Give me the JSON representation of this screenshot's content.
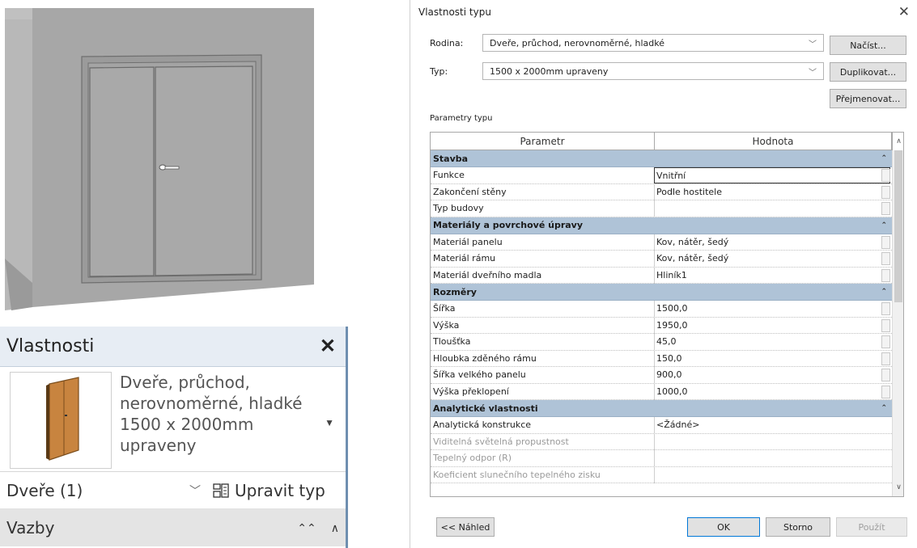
{
  "dialog": {
    "title": "Vlastnosti typu",
    "close_glyph": "✕",
    "family_label": "Rodina:",
    "family_value": "Dveře, průchod, nerovnoměrné, hladké",
    "type_label": "Typ:",
    "type_value": "1500 x 2000mm upraveny",
    "load_button": "Načíst...",
    "duplicate_button": "Duplikovat...",
    "rename_button": "Přejmenovat...",
    "section_label": "Parametry typu",
    "col_param": "Parametr",
    "col_value": "Hodnota",
    "col_eq": "=",
    "groups": [
      {
        "name": "Stavba",
        "rows": [
          {
            "name": "Funkce",
            "value": "Vnitřní"
          },
          {
            "name": "Zakončení stěny",
            "value": "Podle hostitele"
          },
          {
            "name": "Typ budovy",
            "value": ""
          }
        ]
      },
      {
        "name": "Materiály a povrchové úpravy",
        "rows": [
          {
            "name": "Materiál panelu",
            "value": "Kov, nátěr, šedý"
          },
          {
            "name": "Materiál rámu",
            "value": "Kov, nátěr, šedý"
          },
          {
            "name": "Materiál dveřního madla",
            "value": "Hliník1"
          }
        ]
      },
      {
        "name": "Rozměry",
        "rows": [
          {
            "name": "Šířka",
            "value": "1500,0"
          },
          {
            "name": "Výška",
            "value": "1950,0"
          },
          {
            "name": "Tloušťka",
            "value": "45,0"
          },
          {
            "name": "Hloubka zděného rámu",
            "value": "150,0"
          },
          {
            "name": "Šířka velkého panelu",
            "value": "900,0"
          },
          {
            "name": "Výška překlopení",
            "value": "1000,0"
          }
        ]
      },
      {
        "name": "Analytické vlastnosti",
        "rows": [
          {
            "name": "Analytická konstrukce",
            "value": "<Žádné>"
          },
          {
            "name": "Viditelná světelná propustnost",
            "value": ""
          },
          {
            "name": "Tepelný odpor (R)",
            "value": ""
          },
          {
            "name": "Koeficient slunečního tepelného zisku",
            "value": ""
          }
        ]
      }
    ],
    "preview_button": "<< Náhled",
    "ok_button": "OK",
    "cancel_button": "Storno",
    "apply_button": "Použít"
  },
  "palette": {
    "title": "Vlastnosti",
    "close_glyph": "✕",
    "type_name_lines": [
      "Dveře, průchod,",
      "nerovnoměrné, hladké",
      "1500 x 2000mm",
      "upraveny"
    ],
    "instance_filter": "Dveře (1)",
    "edit_type": "Upravit typ",
    "group": "Vazby"
  },
  "colors": {
    "accent": "#0078d7",
    "group_header": "#afc3d7",
    "wall": "#a7a7a7",
    "door_thumb": "#c8843f"
  }
}
